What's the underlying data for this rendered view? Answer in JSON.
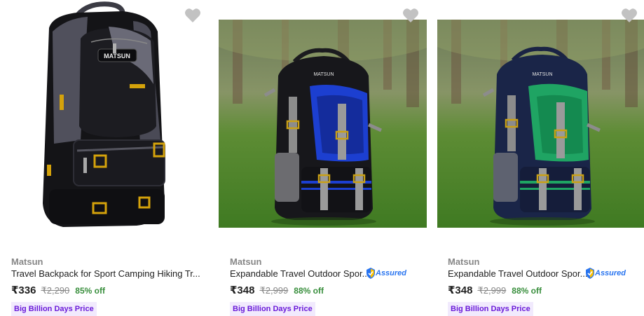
{
  "products": [
    {
      "brand": "Matsun",
      "title": "Travel Backpack for Sport Camping Hiking Tr...",
      "price": "₹336",
      "mrp": "₹2,290",
      "discount": "85% off",
      "offer_tag": "Big Billion Days Price",
      "assured": false,
      "bag_brand_text": "MATSUN",
      "accent_color": "#3a3a42"
    },
    {
      "brand": "Matsun",
      "title": "Expandable Travel Outdoor Spor...",
      "price": "₹348",
      "mrp": "₹2,999",
      "discount": "88% off",
      "offer_tag": "Big Billion Days Price",
      "assured": true,
      "assured_label": "Assured",
      "bag_brand_text": "MATSUN",
      "accent_color": "#1c3fd0"
    },
    {
      "brand": "Matsun",
      "title": "Expandable Travel Outdoor Spor...",
      "price": "₹348",
      "mrp": "₹2,999",
      "discount": "88% off",
      "offer_tag": "Big Billion Days Price",
      "assured": true,
      "assured_label": "Assured",
      "bag_brand_text": "MATSUN",
      "accent_color": "#1fa463"
    }
  ],
  "colors": {
    "discount_green": "#388e3c",
    "offer_purple": "#6a1bd9",
    "offer_bg": "#f1eafd",
    "assured_blue": "#2874f0",
    "heart_grey": "#c2c2c2",
    "grass": "#4f8a2c"
  },
  "icons": {
    "wishlist": "heart-icon",
    "assured": "shield-check-icon"
  }
}
